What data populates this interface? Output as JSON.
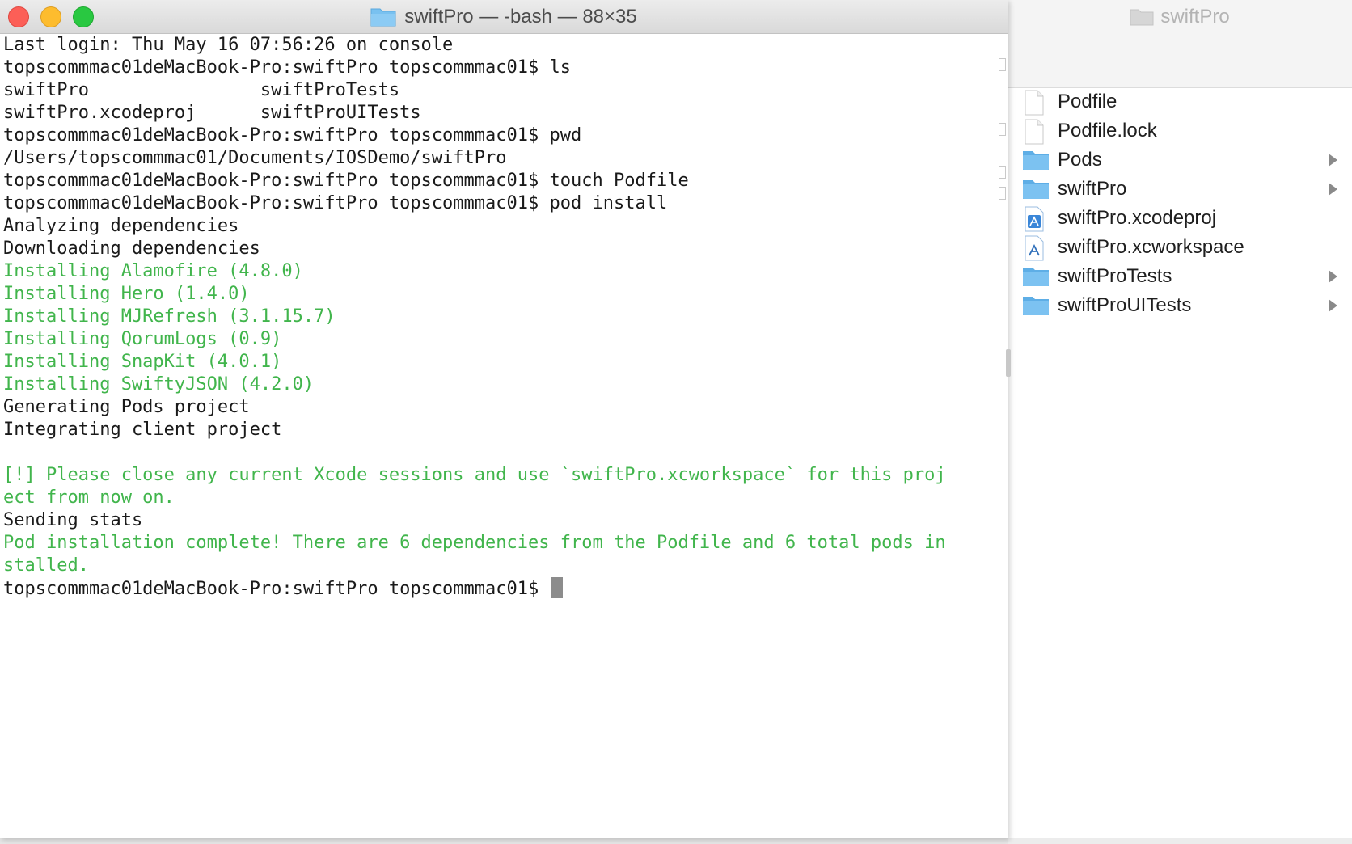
{
  "finder": {
    "title": "swiftPro",
    "items": [
      {
        "name": "Podfile",
        "type": "file",
        "icon": "document-icon"
      },
      {
        "name": "Podfile.lock",
        "type": "file",
        "icon": "document-icon"
      },
      {
        "name": "Pods",
        "type": "folder",
        "icon": "folder-icon"
      },
      {
        "name": "swiftPro",
        "type": "folder",
        "icon": "folder-icon"
      },
      {
        "name": "swiftPro.xcodeproj",
        "type": "xcode",
        "icon": "xcodeproj-icon"
      },
      {
        "name": "swiftPro.xcworkspace",
        "type": "xcode",
        "icon": "xcworkspace-icon"
      },
      {
        "name": "swiftProTests",
        "type": "folder",
        "icon": "folder-icon"
      },
      {
        "name": "swiftProUITests",
        "type": "folder",
        "icon": "folder-icon"
      }
    ]
  },
  "terminal": {
    "title": "swiftPro — -bash — 88×35",
    "lines": [
      {
        "text": "Last login: Thu May 16 07:56:26 on console",
        "color": "default"
      },
      {
        "text": "topscommmac01deMacBook-Pro:swiftPro topscommmac01$ ls",
        "color": "default"
      },
      {
        "text": "swiftPro                swiftProTests",
        "color": "default"
      },
      {
        "text": "swiftPro.xcodeproj      swiftProUITests",
        "color": "default"
      },
      {
        "text": "topscommmac01deMacBook-Pro:swiftPro topscommmac01$ pwd",
        "color": "default"
      },
      {
        "text": "/Users/topscommmac01/Documents/IOSDemo/swiftPro",
        "color": "default"
      },
      {
        "text": "topscommmac01deMacBook-Pro:swiftPro topscommmac01$ touch Podfile",
        "color": "default"
      },
      {
        "text": "topscommmac01deMacBook-Pro:swiftPro topscommmac01$ pod install",
        "color": "default"
      },
      {
        "text": "Analyzing dependencies",
        "color": "default"
      },
      {
        "text": "Downloading dependencies",
        "color": "default"
      },
      {
        "text": "Installing Alamofire (4.8.0)",
        "color": "green"
      },
      {
        "text": "Installing Hero (1.4.0)",
        "color": "green"
      },
      {
        "text": "Installing MJRefresh (3.1.15.7)",
        "color": "green"
      },
      {
        "text": "Installing QorumLogs (0.9)",
        "color": "green"
      },
      {
        "text": "Installing SnapKit (4.0.1)",
        "color": "green"
      },
      {
        "text": "Installing SwiftyJSON (4.2.0)",
        "color": "green"
      },
      {
        "text": "Generating Pods project",
        "color": "default"
      },
      {
        "text": "Integrating client project",
        "color": "default"
      },
      {
        "text": "",
        "color": "default"
      },
      {
        "text": "[!] Please close any current Xcode sessions and use `swiftPro.xcworkspace` for this proj",
        "color": "green"
      },
      {
        "text": "ect from now on.",
        "color": "green"
      },
      {
        "text": "Sending stats",
        "color": "default"
      },
      {
        "text": "Pod installation complete! There are 6 dependencies from the Podfile and 6 total pods in",
        "color": "green"
      },
      {
        "text": "stalled.",
        "color": "green"
      }
    ],
    "prompt": "topscommmac01deMacBook-Pro:swiftPro topscommmac01$ "
  },
  "colors": {
    "green_output": "#41b54c",
    "folder_blue": "#6fb8ec",
    "close": "#fc5f57",
    "minimize": "#fdbc2e",
    "maximize": "#29c841"
  }
}
